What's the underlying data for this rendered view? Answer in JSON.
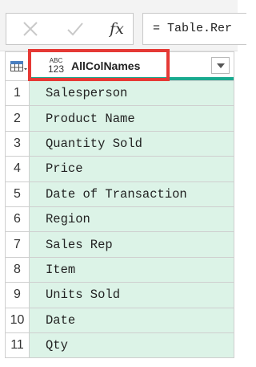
{
  "formula_bar": {
    "cancel_icon": "close-icon",
    "accept_icon": "check-icon",
    "fx_label": "fx",
    "formula_text": "= Table.Rer"
  },
  "grid": {
    "corner_icon": "table-icon",
    "column": {
      "type_icon_top": "ABC",
      "type_icon_bottom": "123",
      "name": "AllColNames",
      "dropdown_icon": "chevron-down-icon",
      "header_accent": "#1aaa8f",
      "highlight_color": "#e53935"
    },
    "rows": [
      {
        "num": "1",
        "value": "Salesperson"
      },
      {
        "num": "2",
        "value": "Product Name"
      },
      {
        "num": "3",
        "value": "Quantity Sold"
      },
      {
        "num": "4",
        "value": "Price"
      },
      {
        "num": "5",
        "value": "Date of Transaction"
      },
      {
        "num": "6",
        "value": "Region"
      },
      {
        "num": "7",
        "value": "Sales Rep"
      },
      {
        "num": "8",
        "value": "Item"
      },
      {
        "num": "9",
        "value": "Units Sold"
      },
      {
        "num": "10",
        "value": "Date"
      },
      {
        "num": "11",
        "value": "Qty"
      }
    ]
  }
}
